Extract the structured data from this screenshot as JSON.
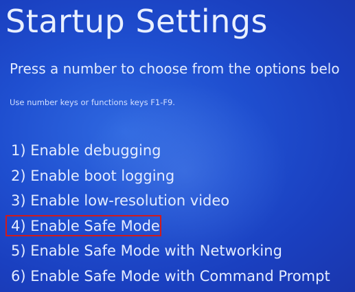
{
  "title": "Startup Settings",
  "subtitle": "Press a number to choose from the options belo",
  "hint": "Use number keys or functions keys F1-F9.",
  "options": [
    "1) Enable debugging",
    "2) Enable boot logging",
    "3) Enable low-resolution video",
    "4) Enable Safe Mode",
    "5) Enable Safe Mode with Networking",
    "6) Enable Safe Mode with Command Prompt"
  ],
  "highlighted_option": "4) Enable Safe Mode",
  "colors": {
    "background": "#1f4fd0",
    "text": "#e4ecff",
    "highlight_border": "#d21a1a"
  }
}
